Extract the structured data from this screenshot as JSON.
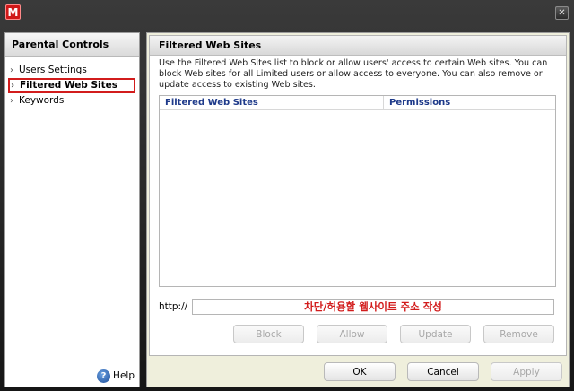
{
  "window": {
    "logo_letter": "M",
    "close_glyph": "✕"
  },
  "sidebar": {
    "title": "Parental Controls",
    "items": [
      {
        "label": "Users Settings"
      },
      {
        "label": "Filtered Web Sites"
      },
      {
        "label": "Keywords"
      }
    ],
    "active_item": "Filtered Web Sites",
    "help_label": "Help",
    "help_icon_glyph": "?"
  },
  "panel": {
    "title": "Filtered Web Sites",
    "description": "Use the Filtered Web Sites list to block or allow users' access to certain Web sites. You can block Web sites for all Limited users or allow access to everyone. You can also remove or update access to existing Web sites.",
    "table": {
      "columns": [
        "Filtered Web Sites",
        "Permissions"
      ],
      "rows": []
    },
    "url": {
      "label": "http://",
      "value": "",
      "placeholder": "차단/허용할 웹사이트 주소 작성"
    },
    "actions": {
      "block": "Block",
      "allow": "Allow",
      "update": "Update",
      "remove": "Remove"
    }
  },
  "footer": {
    "ok": "OK",
    "cancel": "Cancel",
    "apply": "Apply"
  },
  "colors": {
    "highlight_red": "#d21c1c",
    "header_blue": "#1e3a8a",
    "main_background": "#efefdc"
  },
  "icons": {
    "nav_bullet": "chevron-right-icon",
    "help": "help-icon",
    "close": "close-icon",
    "logo": "mcafee-logo-icon"
  }
}
